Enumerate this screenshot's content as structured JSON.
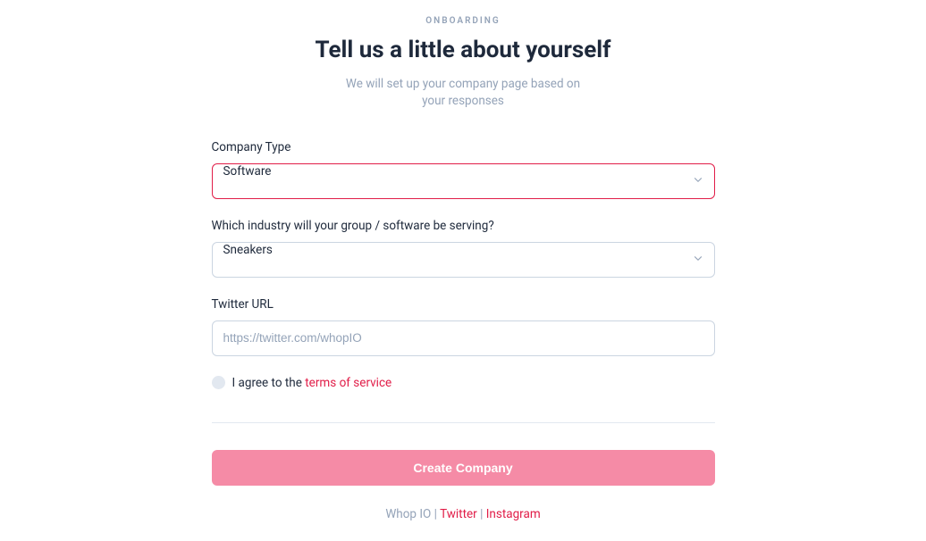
{
  "header": {
    "eyebrow": "ONBOARDING",
    "title": "Tell us a little about yourself",
    "subtitle": "We will set up your company page based on your responses"
  },
  "form": {
    "company_type": {
      "label": "Company Type",
      "value": "Software"
    },
    "industry": {
      "label": "Which industry will your group / software be serving?",
      "value": "Sneakers"
    },
    "twitter": {
      "label": "Twitter URL",
      "placeholder": "https://twitter.com/whopIO",
      "value": ""
    },
    "agreement": {
      "prefix": "I agree to the ",
      "link_text": "terms of service"
    }
  },
  "submit_label": "Create Company",
  "footer": {
    "brand": "Whop IO",
    "link1": "Twitter",
    "link2": "Instagram",
    "separator": " | "
  }
}
